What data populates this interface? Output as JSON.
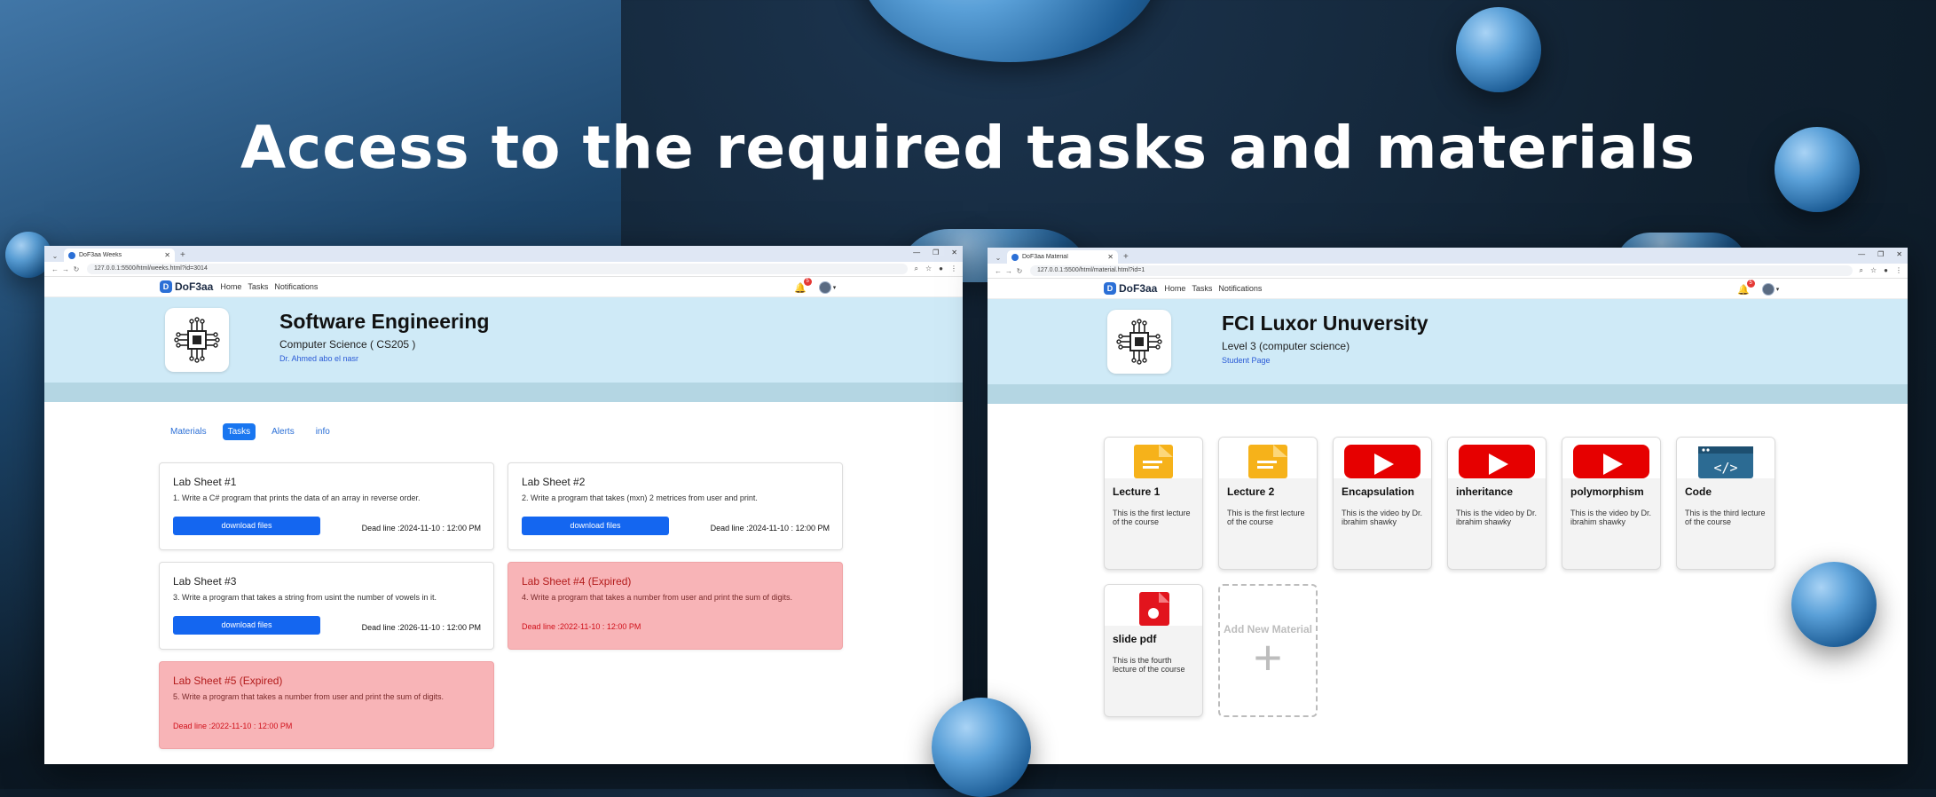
{
  "headline": "Access to the required tasks and materials",
  "colors": {
    "primary": "#1466f0",
    "hero_bg": "#cfeaf7",
    "expired_bg": "#f8b4b7",
    "expired_text": "#d0111b"
  },
  "left_window": {
    "tab_title": "DoF3aa Weeks",
    "url": "127.0.0.1:5500/html/weeks.html?id=3014",
    "brand": "DoF3aa",
    "nav": [
      "Home",
      "Tasks",
      "Notifications"
    ],
    "notification_count": "5",
    "course": {
      "title": "Software Engineering",
      "subtitle": "Computer Science ( CS205 )",
      "instructor": "Dr. Ahmed abo el nasr"
    },
    "tabs": [
      "Materials",
      "Tasks",
      "Alerts",
      "info"
    ],
    "active_tab": "Tasks",
    "download_label": "download files",
    "tasks": [
      {
        "title": "Lab Sheet #1",
        "desc": "1. Write a C# program that prints the data of an array in reverse order.",
        "deadline": "Dead line :2024-11-10 : 12:00 PM",
        "expired": false
      },
      {
        "title": "Lab Sheet #2",
        "desc": "2. Write a program that takes (mxn) 2 metrices from user and print.",
        "deadline": "Dead line :2024-11-10 : 12:00 PM",
        "expired": false
      },
      {
        "title": "Lab Sheet #3",
        "desc": "3. Write a program that takes a string from usint the number of vowels in it.",
        "deadline": "Dead line :2026-11-10 : 12:00 PM",
        "expired": false
      },
      {
        "title": "Lab Sheet #4 (Expired)",
        "desc": "4. Write a program that takes a number from user and print the sum of digits.",
        "deadline": "Dead line :2022-11-10 : 12:00 PM",
        "expired": true
      },
      {
        "title": "Lab Sheet #5 (Expired)",
        "desc": "5. Write a program that takes a number from user and print the sum of digits.",
        "deadline": "Dead line :2022-11-10 : 12:00 PM",
        "expired": true
      }
    ]
  },
  "right_window": {
    "tab_title": "DoF3aa Material",
    "url": "127.0.0.1:5500/html/material.html?id=1",
    "brand": "DoF3aa",
    "nav": [
      "Home",
      "Tasks",
      "Notifications"
    ],
    "notification_count": "5",
    "course": {
      "title": "FCI Luxor Unuversity",
      "subtitle": "Level 3 (computer science)",
      "link": "Student Page"
    },
    "materials": [
      {
        "name": "Lecture 1",
        "desc": "This is the first lecture of the course",
        "icon": "document-icon"
      },
      {
        "name": "Lecture 2",
        "desc": "This is the first lecture of the course",
        "icon": "document-icon"
      },
      {
        "name": "Encapsulation",
        "desc": "This is the video by Dr. ibrahim shawky",
        "icon": "youtube-icon"
      },
      {
        "name": "inheritance",
        "desc": "This is the video by Dr. ibrahim shawky",
        "icon": "youtube-icon"
      },
      {
        "name": "polymorphism",
        "desc": "This is the video by Dr. ibrahim shawky",
        "icon": "youtube-icon"
      },
      {
        "name": "Code",
        "desc": "This is the third lecture of the course",
        "icon": "code-icon"
      },
      {
        "name": "slide pdf",
        "desc": "This is the fourth lecture of the course",
        "icon": "pdf-icon"
      }
    ],
    "add_material_label": "Add New Material"
  }
}
